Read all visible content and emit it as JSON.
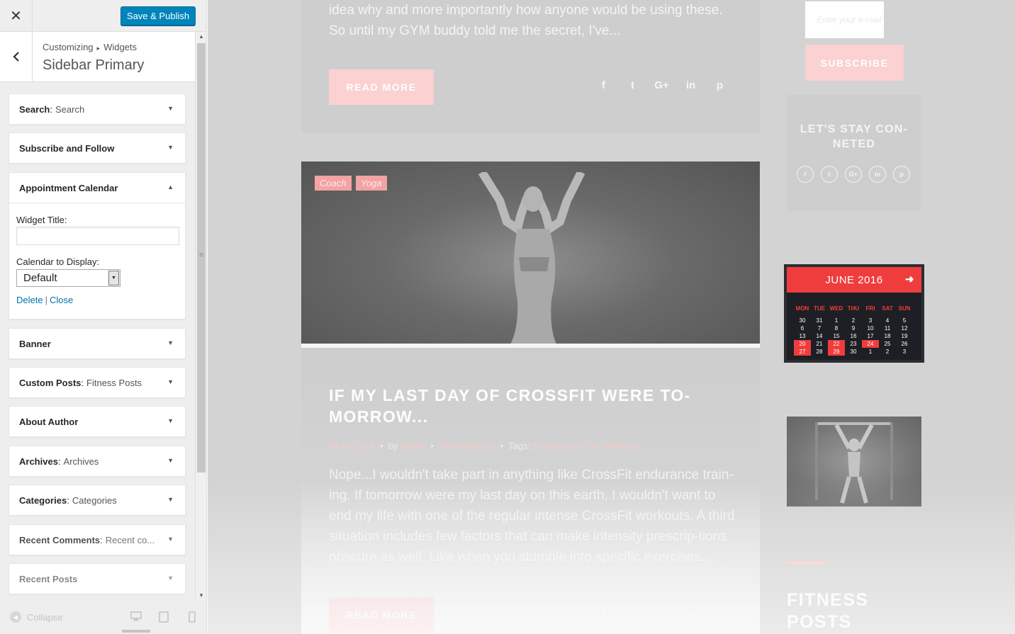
{
  "customizer": {
    "close_icon": "close-icon",
    "save_label": "Save & Publish",
    "breadcrumb": [
      "Customizing",
      "Widgets"
    ],
    "title": "Sidebar Primary",
    "widgets": [
      {
        "name": "Search",
        "sub": "Search"
      },
      {
        "name": "Subscribe and Follow",
        "sub": ""
      },
      {
        "name": "Appointment Calendar",
        "sub": "",
        "expanded": true
      },
      {
        "name": "Banner",
        "sub": ""
      },
      {
        "name": "Custom Posts",
        "sub": "Fitness Posts"
      },
      {
        "name": "About Author",
        "sub": ""
      },
      {
        "name": "Archives",
        "sub": "Archives"
      },
      {
        "name": "Categories",
        "sub": "Categories"
      },
      {
        "name": "Recent Comments",
        "sub": "Recent co..."
      },
      {
        "name": "Recent Posts",
        "sub": ""
      }
    ],
    "appointment_form": {
      "title_label": "Widget Title:",
      "title_value": "",
      "calendar_label": "Calendar to Display:",
      "calendar_value": "Default",
      "delete_label": "Delete",
      "separator": "|",
      "close_label": "Close"
    },
    "footer": {
      "collapse_label": "Collapse",
      "devices": [
        "desktop",
        "tablet",
        "mobile"
      ],
      "active_device": "desktop"
    }
  },
  "preview": {
    "post1": {
      "excerpt": "idea why and more importantly how anyone would be using these. So until my GYM buddy told me the secret, I've...",
      "read_more": "READ MORE"
    },
    "socials": [
      "f",
      "t",
      "G+",
      "in",
      "p"
    ],
    "post2": {
      "tags": [
        "Coach",
        "Yoga"
      ],
      "title": "IF MY LAST DAY OF CROSSFIT WERE TO-MORROW...",
      "date": "04.24.2016",
      "by": "by",
      "author": "admin",
      "comments": "comments (0)",
      "tags_label": "Tags:",
      "tag_links": "Exercises, GYM, Workout",
      "excerpt": "Nope...I wouldn't take part in anything like CrossFit endurance train-ing. If tomorrow were my last day on this earth, I wouldn't want to end my life with one of the regular intense CrossFit workouts. A third situation includes few factors that can make intensity prescrip-tions obscure as well. Like when you stumble into specific exercises...",
      "read_more": "READ MORE"
    },
    "sidebar": {
      "email_placeholder": "Enter your e-mail",
      "subscribe_label": "SUBSCRIBE",
      "stay_title": "LET'S STAY CON-NETED",
      "stay_icons": [
        "f",
        "t",
        "G+",
        "in",
        "p"
      ],
      "fitness_posts_title": "FITNESS POSTS"
    },
    "calendar": {
      "month": "JUNE 2016",
      "next_icon": "arrow-right-icon",
      "dows": [
        "MON",
        "TUE",
        "WED",
        "THU",
        "FRI",
        "SAT",
        "SUN"
      ],
      "weeks": [
        [
          "30",
          "31",
          "1",
          "2",
          "3",
          "4",
          "5"
        ],
        [
          "6",
          "7",
          "8",
          "9",
          "10",
          "11",
          "12"
        ],
        [
          "13",
          "14",
          "15",
          "16",
          "17",
          "18",
          "19"
        ],
        [
          "20",
          "21",
          "22",
          "23",
          "24",
          "25",
          "26"
        ],
        [
          "27",
          "28",
          "29",
          "30",
          "1",
          "2",
          "3"
        ]
      ],
      "highlighted": [
        "20",
        "22",
        "24",
        "27",
        "29"
      ],
      "accent": "#ef3d3d"
    }
  },
  "colors": {
    "primary_button": "#0085ba",
    "link": "#0073aa",
    "pink": "#fbd1d1"
  }
}
